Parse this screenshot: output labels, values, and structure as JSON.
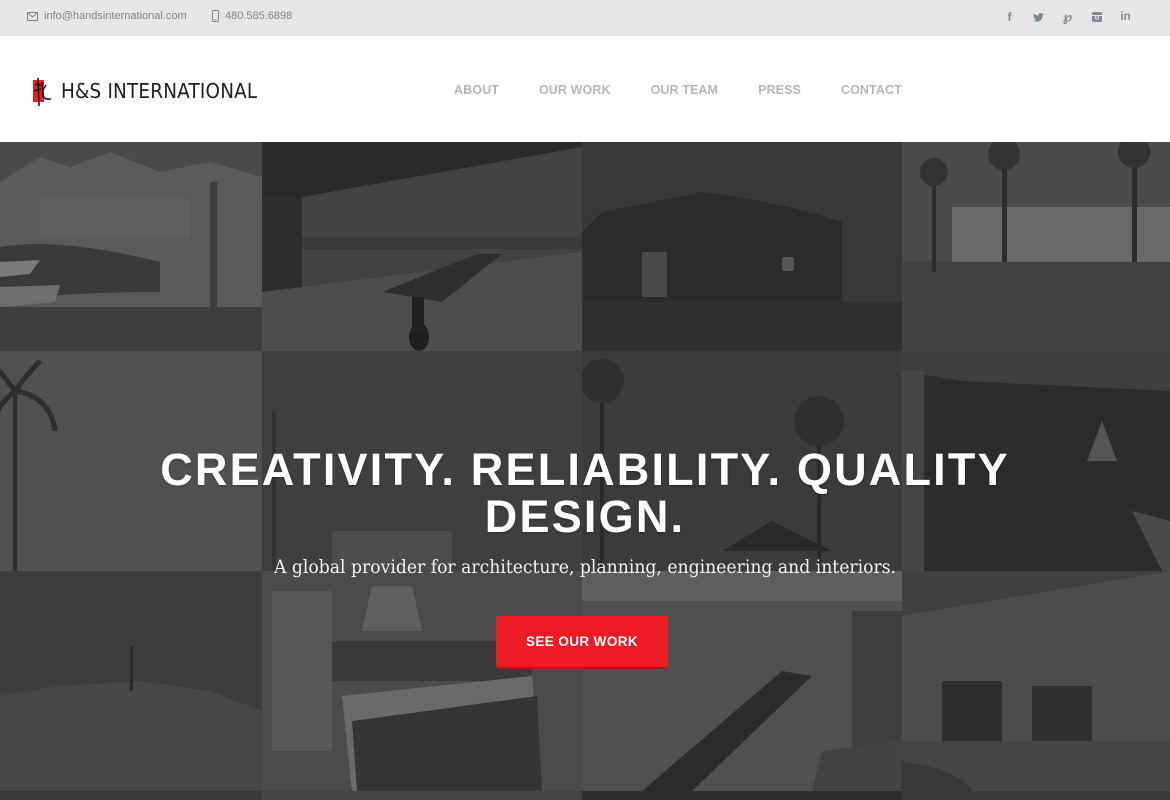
{
  "topbar": {
    "email": "info@handsinternational.com",
    "phone": "480.585.6898",
    "email_icon": "envelope-icon",
    "phone_icon": "mobile-phone-icon",
    "social": [
      {
        "name": "facebook",
        "glyph": "f"
      },
      {
        "name": "twitter",
        "glyph": "t"
      },
      {
        "name": "pinterest",
        "glyph": "p"
      },
      {
        "name": "instagram",
        "glyph": "i"
      },
      {
        "name": "linkedin",
        "glyph": "in"
      }
    ]
  },
  "header": {
    "logo_text": "H&S INTERNATIONAL",
    "nav": [
      "ABOUT",
      "OUR WORK",
      "OUR TEAM",
      "PRESS",
      "CONTACT"
    ]
  },
  "hero": {
    "headline": "CREATIVITY. RELIABILITY. QUALITY DESIGN.",
    "tagline": "A global provider for architecture, planning, engineering and interiors.",
    "cta_label": "SEE OUR WORK",
    "tiles": [
      "desert-golf-resort",
      "infinity-pool-terrace",
      "modern-house-dusk",
      "palm-pool-villa",
      "palm-tree-sky",
      "modern-building-palms",
      "tropical-resort-palms",
      "restaurant-interior",
      "desert-hillside",
      "kitchen-interior",
      "city-aerial-canal",
      "retail-building-plaza"
    ]
  },
  "colors": {
    "accent": "#ed1c24",
    "topbar_bg": "#e6e7e9",
    "nav_text": "#b5b5b5",
    "topbar_text": "#7a8592"
  }
}
